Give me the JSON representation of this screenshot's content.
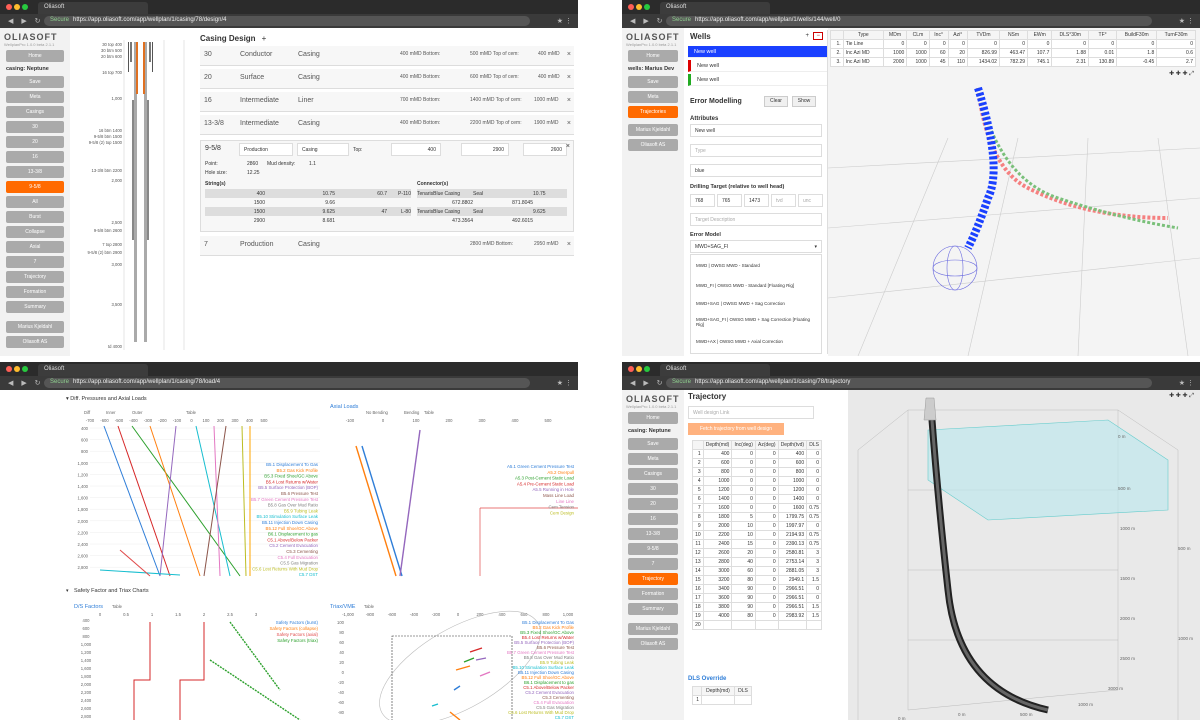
{
  "colors": {
    "accent": "#ff6a00",
    "blue": "#1a40ff",
    "sidebar_btn": "#aaaaaa"
  },
  "browser": {
    "tab_title": "Oliasoft",
    "secure_label": "Secure",
    "url1": "https://app.oliasoft.com/app/wellplan/1/casing/78/design/4",
    "url2": "https://app.oliasoft.com/app/wellplan/1/wells/144/well/0",
    "url3": "https://app.oliasoft.com/app/wellplan/1/casing/78/load/4",
    "url4": "https://app.oliasoft.com/app/wellplan/1/casing/78/trajectory"
  },
  "logo": "OLIASOFT",
  "logo_sub": "WellplanPro 1.0.0 beta 2.1.1",
  "q1": {
    "context": "casing: Neptune",
    "nav": [
      "Home",
      "Save",
      "Meta",
      "Casings",
      "30",
      "20",
      "16",
      "13-3/8",
      "9-5/8",
      "All",
      "Burst",
      "Collapse",
      "Axial",
      "7",
      "Trajectory",
      "Formation",
      "Summary"
    ],
    "active": "9-5/8",
    "user": "Marius Kjeldahl",
    "company": "Oliasoft AS",
    "title": "Casing Design",
    "add": "+",
    "casings": [
      {
        "size": "30",
        "type": "Conductor",
        "kind": "Casing",
        "top": "400 mMD Bottom:",
        "bottom": "500 mMD Top of cem:",
        "toc": "400 mMD"
      },
      {
        "size": "20",
        "type": "Surface",
        "kind": "Casing",
        "top": "400 mMD Bottom:",
        "bottom": "600 mMD Top of cem:",
        "toc": "400 mMD"
      },
      {
        "size": "16",
        "type": "Intermediate",
        "kind": "Liner",
        "top": "700 mMD Bottom:",
        "bottom": "1400 mMD Top of cem:",
        "toc": "1000 mMD"
      },
      {
        "size": "13-3/8",
        "type": "Intermediate",
        "kind": "Casing",
        "top": "400 mMD Bottom:",
        "bottom": "2200 mMD Top of cem:",
        "toc": "1900 mMD"
      }
    ],
    "detail": {
      "size": "9-5/8",
      "type": "Production",
      "kind": "Casing",
      "top_label": "Top:",
      "top": "400",
      "bottom": "2900",
      "toc": "2600",
      "mwd": "Mud density:",
      "mw_val": "1.1",
      "points": "Point:",
      "pt": "2860",
      "holesize": "Hole size:",
      "hs": "12.25",
      "strings_title": "String(s)",
      "connectors_title": "Connector(s)",
      "strings": [
        [
          "400",
          "10.75",
          "60.7",
          "P-110"
        ],
        [
          "1500",
          "9.66",
          "",
          ""
        ],
        [
          "1500",
          "9.625",
          "47",
          "L-80"
        ],
        [
          "2900",
          "8.681",
          "",
          ""
        ]
      ],
      "connectors": [
        [
          "TenarisBlue Casing",
          "Seal",
          "10.75"
        ],
        [
          "672.8802",
          "871.8045",
          ""
        ],
        [
          "TenarisBlue Casing",
          "Seal",
          "9.625"
        ],
        [
          "473.3564",
          "492.6015",
          ""
        ]
      ]
    },
    "last": {
      "size": "7",
      "type": "Production",
      "kind": "Casing",
      "top": "2800 mMD Bottom:",
      "toc": "2950 mMD"
    },
    "schematic_labels": [
      "30 top 400",
      "30 btm 500",
      "20 btm 600",
      "16 top 700",
      "1,000",
      "16 btm 1400",
      "9-5/8 btm 1500",
      "9-5/8 (2) top 1500",
      "13-3/8 btm 2200",
      "2,000",
      "2,500",
      "9-5/8 btm 2600",
      "7 top 2800",
      "9-5/8 (2) btm 2900",
      "3,000",
      "3,500",
      "td 4000"
    ]
  },
  "q2": {
    "title": "Wells",
    "wells": [
      "New well",
      "New well",
      "New well"
    ],
    "context": "wells: Marius Dev",
    "nav": [
      "Home",
      "Save",
      "Meta",
      "Trajectories"
    ],
    "user": "Marius Kjeldahl",
    "company": "Oliasoft AS",
    "err_title": "Error Modelling",
    "clear": "Clear",
    "show": "Show",
    "attributes": "Attributes",
    "attr_name": "New well",
    "attr_type": "Type",
    "attr_color": "blue",
    "target_title": "Drilling Target (relative to well head)",
    "target": [
      "768",
      "765",
      "1473",
      "tvd",
      "unc"
    ],
    "target_desc": "Target Description",
    "em_title": "Error Model",
    "em_value": "MWD+SAG_FI",
    "em_options": [
      "MWD | OWSG MWD - Standard",
      "MWD_FI | OWSG MWD - Standard [Floating Rig]",
      "MWD+SAG | OWSG MWD + Sag Correction",
      "MWD+SAG_FI | OWSG MWD + Sag Correction [Floating Rig]",
      "MWD+AX | OWSG MWD + Axial Correction"
    ],
    "table_headers": [
      "",
      "Type",
      "MDm",
      "CLm",
      "Inc°",
      "Azi°",
      "TVDm",
      "NSm",
      "EWm",
      "DLS°30m",
      "TF°",
      "BuildF30m",
      "TurnF30m"
    ],
    "table_rows": [
      [
        "1.",
        "Tie Line",
        "0",
        "0",
        "0",
        "0",
        "0",
        "0",
        "0",
        "0",
        "0",
        "0",
        "0"
      ],
      [
        "2.",
        "Inc Azi MD",
        "1000",
        "1000",
        "60",
        "20",
        "826.99",
        "463.47",
        "107.7",
        "1.88",
        "0.01",
        "1.8",
        "0.6"
      ],
      [
        "3.",
        "Inc Azi MD",
        "2000",
        "1000",
        "45",
        "110",
        "1434.02",
        "782.29",
        "745.1",
        "2.31",
        "130.89",
        "-0.45",
        "2.7"
      ]
    ]
  },
  "q3": {
    "sec1": "Diff. Pressures and Axial Loads",
    "sec2": "Safety Factor and Triax Charts",
    "dp_axis": [
      "Diff",
      "Inner",
      "Outer",
      "Table"
    ],
    "dp_x": [
      "-700",
      "-600",
      "-500",
      "-400",
      "-300",
      "-200",
      "-100",
      "0",
      "100",
      "200",
      "300",
      "400",
      "500"
    ],
    "depth_ticks": [
      "400",
      "600",
      "800",
      "1,000",
      "1,200",
      "1,400",
      "1,600",
      "1,800",
      "2,000",
      "2,200",
      "2,400",
      "2,600",
      "2,800"
    ],
    "ax_title": "Axial Loads",
    "ax_axis": [
      "No Bending",
      "Bending",
      "Table"
    ],
    "ax_x": [
      "-100",
      "0",
      "100",
      "200",
      "300",
      "400",
      "500"
    ],
    "dp_legend": [
      "B5.1 Displacement To Gas",
      "B5.2 Gas Kick Profile",
      "B5.3 Fixed Shoe/GC Above",
      "B5.4 Lost Returns w/Water",
      "B5.5 Surface Protection (BOP)",
      "B5.6 Pressure Test",
      "B5.7 Green Cement Pressure Test",
      "B5.8 Gas Over Mud Ratio",
      "B5.9 Tubing Leak",
      "B5.10 Stimulation Surface Leak",
      "B5.11 Injection Down Casing",
      "B5.12 Full Shoe/GC Above",
      "B6.1 Displacement to gas",
      "C5.1 Above/Below Packer",
      "C5.2 Cement Evacuation",
      "C5.3 Cementing",
      "C5.4 Full Evacuation",
      "C5.5 Gas Migration",
      "C5.6 Lost Returns With Mud Drop",
      "C5.7 DST"
    ],
    "ax_legend": [
      "A5.1 Green Cement Pressure Test",
      "A5.2 Overpull",
      "A5.3 Post-Cement Static Load",
      "A5.4 Pre-Cement Static Load",
      "A5.5 Running in Hole",
      "Mass Line Load",
      "Line Line",
      "Cem Tension",
      "Cem Design"
    ],
    "sf_title": "D/S Factors",
    "sf_axis": "Table",
    "sf_x": [
      "0",
      "0.5",
      "1",
      "1.5",
      "2",
      "2.5",
      "3"
    ],
    "sf_legend": [
      "Safety Factors (burst)",
      "Safety Factors (collapse)",
      "Safety Factors (axial)",
      "Safety Factors (triax)"
    ],
    "tr_title": "Triax/VME",
    "tr_axis": "Table",
    "tr_x": [
      "-1,000",
      "-800",
      "-600",
      "-400",
      "-200",
      "0",
      "200",
      "400",
      "600",
      "800",
      "1,000"
    ],
    "tr_y": [
      "100",
      "80",
      "60",
      "40",
      "20",
      "0",
      "-20",
      "-40",
      "-60",
      "-80"
    ]
  },
  "q4": {
    "title": "Trajectory",
    "context": "casing: Neptune",
    "input_placeholder": "Well design Link",
    "fetch": "Fetch trajectory from well design",
    "nav": [
      "Home",
      "Save",
      "Meta",
      "Casings",
      "30",
      "20",
      "16",
      "13-3/8",
      "9-5/8",
      "7",
      "Trajectory",
      "Formation",
      "Summary"
    ],
    "active": "Trajectory",
    "user": "Marius Kjeldahl",
    "company": "Oliasoft AS",
    "headers": [
      "",
      "Depth(md)",
      "Inc(deg)",
      "Az(deg)",
      "Depth(tvd)",
      "DLS"
    ],
    "rows": [
      [
        "1",
        "400",
        "0",
        "0",
        "400",
        "0"
      ],
      [
        "2",
        "600",
        "0",
        "0",
        "600",
        "0"
      ],
      [
        "3",
        "800",
        "0",
        "0",
        "800",
        "0"
      ],
      [
        "4",
        "1000",
        "0",
        "0",
        "1000",
        "0"
      ],
      [
        "5",
        "1200",
        "0",
        "0",
        "1200",
        "0"
      ],
      [
        "6",
        "1400",
        "0",
        "0",
        "1400",
        "0"
      ],
      [
        "7",
        "1600",
        "0",
        "0",
        "1600",
        "0.75"
      ],
      [
        "8",
        "1800",
        "5",
        "0",
        "1799.75",
        "0.75"
      ],
      [
        "9",
        "2000",
        "10",
        "0",
        "1997.97",
        "0"
      ],
      [
        "10",
        "2200",
        "10",
        "0",
        "2194.93",
        "0.75"
      ],
      [
        "11",
        "2400",
        "15",
        "0",
        "2390.13",
        "0.75"
      ],
      [
        "12",
        "2600",
        "20",
        "0",
        "2580.81",
        "3"
      ],
      [
        "13",
        "2800",
        "40",
        "0",
        "2753.14",
        "3"
      ],
      [
        "14",
        "3000",
        "60",
        "0",
        "2881.05",
        "3"
      ],
      [
        "15",
        "3200",
        "80",
        "0",
        "2949.1",
        "1.5"
      ],
      [
        "16",
        "3400",
        "90",
        "0",
        "2966.51",
        "0"
      ],
      [
        "17",
        "3600",
        "90",
        "0",
        "2966.51",
        "0"
      ],
      [
        "18",
        "3800",
        "90",
        "0",
        "2966.51",
        "1.5"
      ],
      [
        "19",
        "4000",
        "80",
        "0",
        "2983.92",
        "1.5"
      ],
      [
        "20",
        "",
        "",
        "",
        "",
        ""
      ]
    ],
    "dls_title": "DLS Override",
    "dls_headers": [
      "",
      "Depth(md)",
      "DLS"
    ],
    "dls_rows": [
      [
        "1",
        "",
        ""
      ]
    ],
    "axis": [
      "0 m",
      "500 m",
      "1000 m",
      "1500 m",
      "2000 m",
      "2500 m",
      "3000 m",
      "0 m",
      "500 m",
      "1000 m",
      "0 m",
      "500 m",
      "1000 m"
    ]
  }
}
